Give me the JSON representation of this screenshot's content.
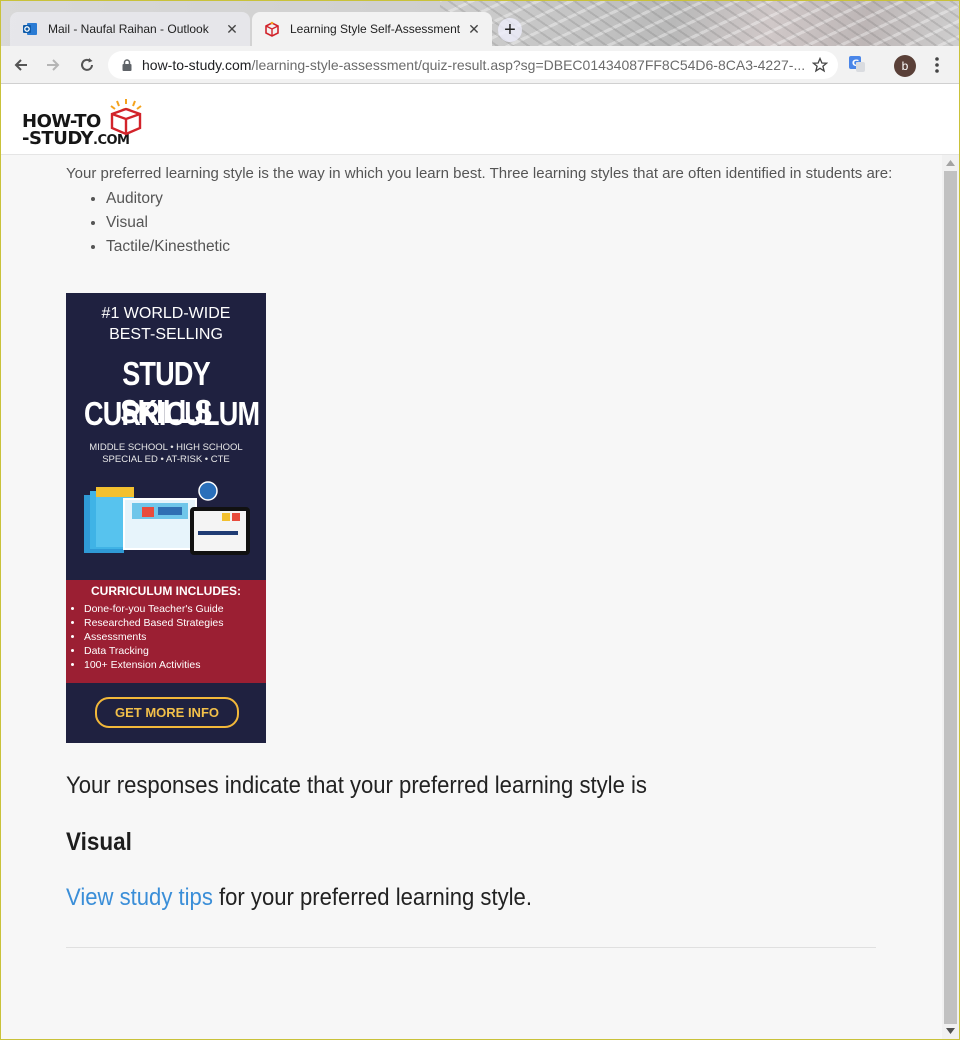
{
  "browser": {
    "tabs": [
      {
        "title": "Mail - Naufal Raihan - Outlook",
        "icon": "outlook-icon",
        "active": false
      },
      {
        "title": "Learning Style Self-Assessment",
        "icon": "howtostudy-box-icon",
        "active": true
      }
    ],
    "new_tab_label": "+",
    "url_host": "how-to-study.com",
    "url_path": "/learning-style-assessment/quiz-result.asp?sg=DBEC01434087FF8C54D6-8CA3-4227-...",
    "profile_initial": "b"
  },
  "site": {
    "logo_line1": "HOW-TO",
    "logo_line2": "-STUDY",
    "logo_com": ".COM"
  },
  "content": {
    "intro": "Your preferred learning style is the way in which you learn best. Three learning styles that are often identified in students are:",
    "styles": [
      "Auditory",
      "Visual",
      "Tactile/Kinesthetic"
    ],
    "ad": {
      "line1": "#1 WORLD-WIDE",
      "line2": "BEST-SELLING",
      "headline1": "STUDY SKILLS",
      "headline2": "CURRICULUM",
      "sub1": "MIDDLE SCHOOL • HIGH SCHOOL",
      "sub2": "SPECIAL ED • AT-RISK • CTE",
      "includes_title": "CURRICULUM INCLUDES:",
      "includes": [
        "Done-for-you Teacher's Guide",
        "Researched Based Strategies",
        "Assessments",
        "Data Tracking",
        "100+ Extension Activities"
      ],
      "cta": "GET MORE INFO"
    },
    "result_text": "Your responses indicate that your preferred learning style is",
    "result_style": "Visual",
    "tips_link": "View study tips",
    "tips_suffix": " for your preferred learning style."
  },
  "colors": {
    "link": "#3a8ed8",
    "ad_navy": "#1f2140",
    "ad_red": "#9b1f33",
    "ad_gold": "#f2b83a",
    "logo_red": "#d2232a"
  }
}
